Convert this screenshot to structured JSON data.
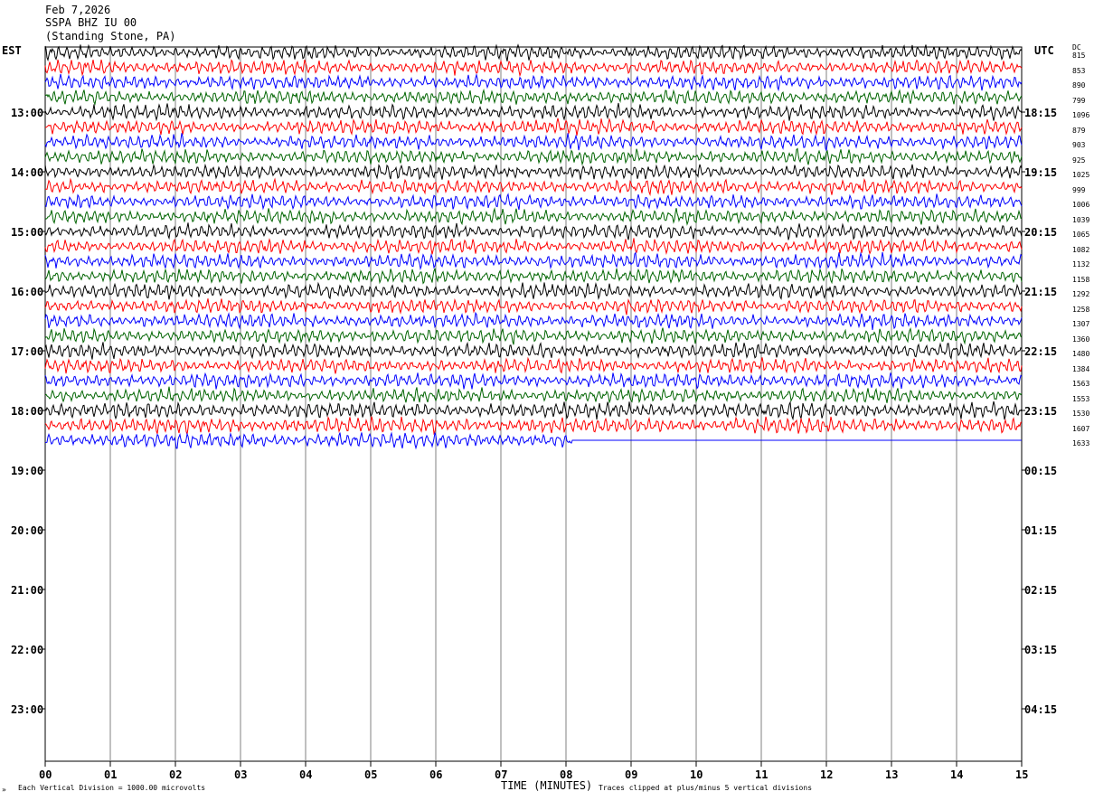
{
  "header": {
    "date": "Feb 7,2026",
    "station": "SSPA BHZ IU 00",
    "location": "(Standing Stone, PA)"
  },
  "left_zone": "EST",
  "right_zone": "UTC",
  "dc_label": "DC",
  "left_hours": [
    "13:00",
    "14:00",
    "15:00",
    "16:00",
    "17:00",
    "18:00",
    "19:00",
    "20:00",
    "21:00",
    "22:00",
    "23:00"
  ],
  "right_hours": [
    "18:15",
    "19:15",
    "20:15",
    "21:15",
    "22:15",
    "23:15",
    "00:15",
    "01:15",
    "02:15",
    "03:15",
    "04:15"
  ],
  "dc_values": [
    "815",
    "853",
    "890",
    "799",
    "1096",
    "879",
    "903",
    "925",
    "1025",
    "999",
    "1006",
    "1039",
    "1065",
    "1082",
    "1132",
    "1158",
    "1292",
    "1258",
    "1307",
    "1360",
    "1480",
    "1384",
    "1563",
    "1553",
    "1530",
    "1607",
    "1633"
  ],
  "footer": {
    "vertical_division": "Each Vertical Division = 1000.00 microvolts",
    "clipping": "Traces clipped at plus/minus 5 vertical divisions",
    "marker": "»"
  },
  "colors": {
    "trace_cycle": [
      "#000000",
      "#ff0000",
      "#0000ff",
      "#006400"
    ],
    "grid": "#808080"
  },
  "chart_data": {
    "type": "line",
    "title": "SSPA BHZ IU 00 (Standing Stone, PA)",
    "xlabel": "TIME (MINUTES)",
    "ylabel": "",
    "x_ticks": [
      "00",
      "01",
      "02",
      "03",
      "04",
      "05",
      "06",
      "07",
      "08",
      "09",
      "10",
      "11",
      "12",
      "13",
      "14",
      "15"
    ],
    "xlim": [
      0,
      15
    ],
    "traces_per_hour": 4,
    "trace_count": 27,
    "last_trace_end_minute": 8.1,
    "grid": true
  }
}
